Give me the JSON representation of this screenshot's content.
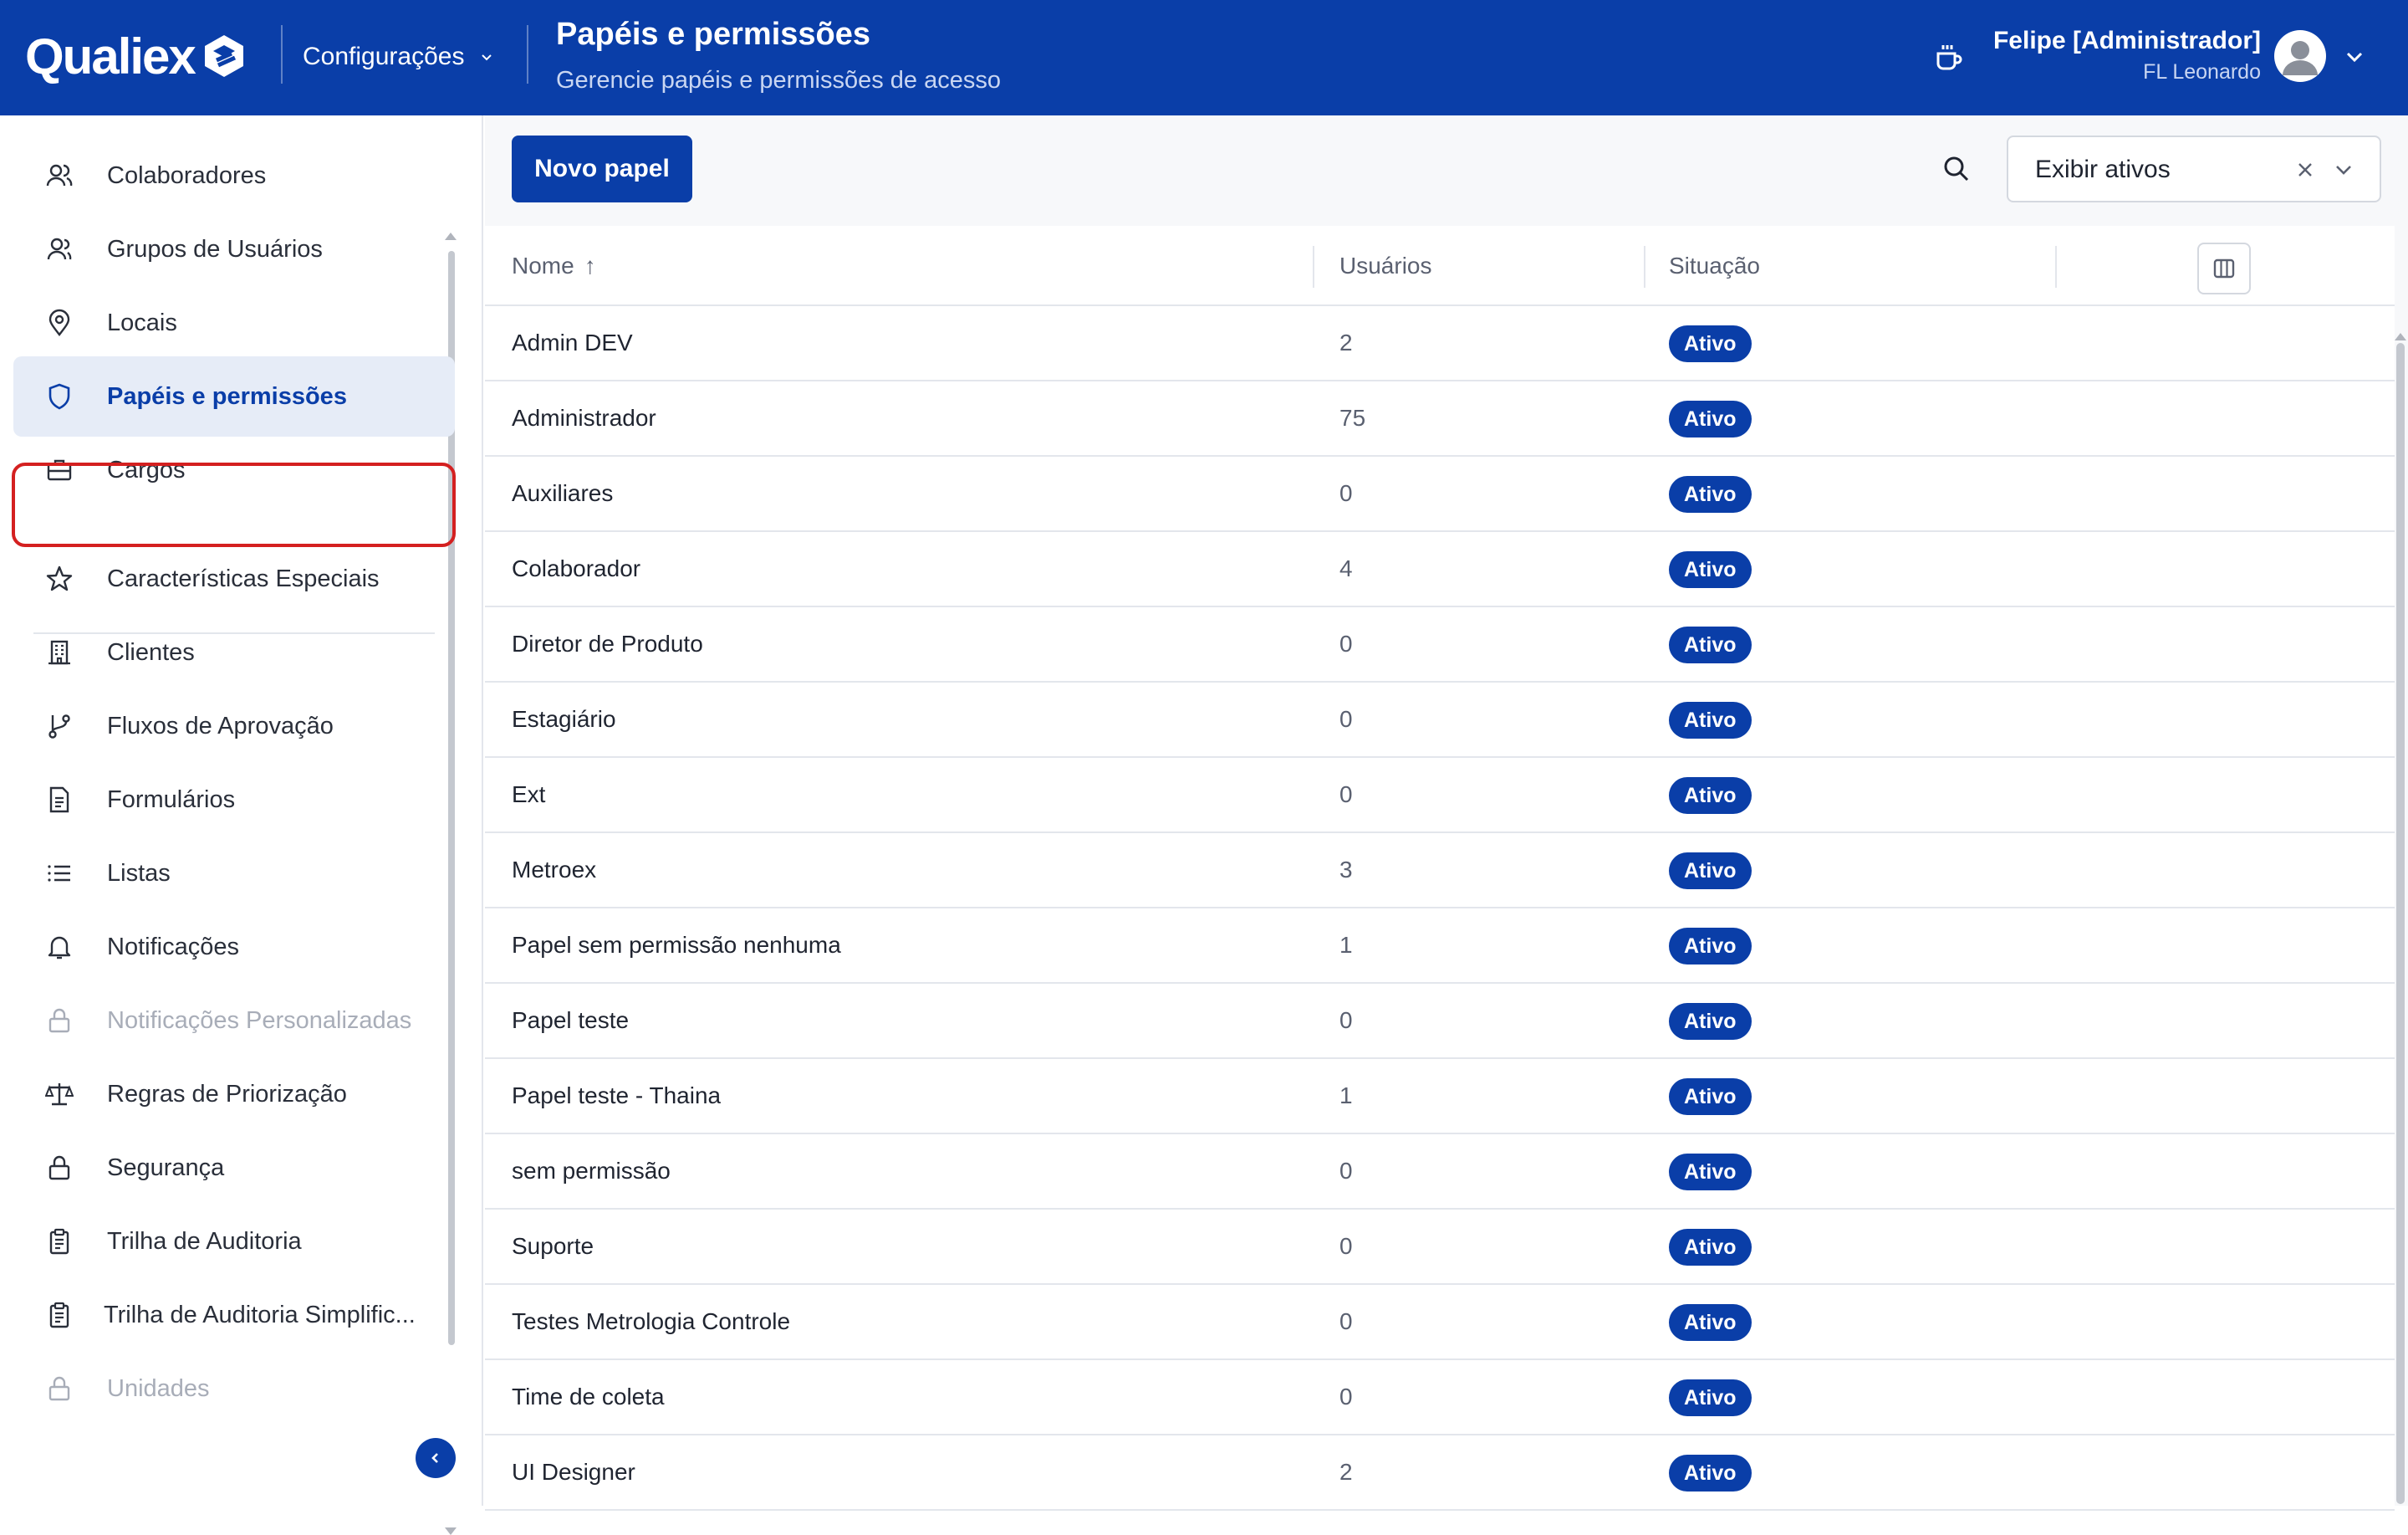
{
  "header": {
    "logo_text": "Qualiex",
    "section_label": "Configurações",
    "title": "Papéis e permissões",
    "subtitle": "Gerencie papéis e permissões de acesso",
    "user_name": "Felipe [Administrador]",
    "user_org": "FL Leonardo",
    "brand_color": "#0a3ea8"
  },
  "sidebar": {
    "items": [
      {
        "label": "Colaboradores",
        "icon": "users-icon"
      },
      {
        "label": "Grupos de Usuários",
        "icon": "user-group-icon"
      },
      {
        "label": "Locais",
        "icon": "map-pin-icon"
      },
      {
        "label": "Papéis e permissões",
        "icon": "shield-icon",
        "active": true
      },
      {
        "label": "Cargos",
        "icon": "briefcase-icon"
      },
      {
        "label": "Características Especiais",
        "icon": "star-icon"
      },
      {
        "label": "Clientes",
        "icon": "building-icon"
      },
      {
        "label": "Fluxos de Aprovação",
        "icon": "git-branch-icon"
      },
      {
        "label": "Formulários",
        "icon": "document-icon"
      },
      {
        "label": "Listas",
        "icon": "list-icon"
      },
      {
        "label": "Notificações",
        "icon": "bell-icon"
      },
      {
        "label": "Notificações Personalizadas",
        "icon": "lock-icon",
        "disabled": true
      },
      {
        "label": "Regras de Priorização",
        "icon": "scale-icon"
      },
      {
        "label": "Segurança",
        "icon": "lock-icon"
      },
      {
        "label": "Trilha de Auditoria",
        "icon": "clipboard-icon"
      },
      {
        "label": "Trilha de Auditoria Simplific...",
        "icon": "clipboard-icon"
      },
      {
        "label": "Unidades",
        "icon": "lock-icon",
        "disabled": true
      }
    ]
  },
  "toolbar": {
    "new_button": "Novo papel",
    "filter_value": "Exibir ativos"
  },
  "table": {
    "columns": [
      "Nome",
      "Usuários",
      "Situação"
    ],
    "sort_indicator": "↑",
    "rows": [
      {
        "name": "Admin DEV",
        "users": "2",
        "status": "Ativo"
      },
      {
        "name": "Administrador",
        "users": "75",
        "status": "Ativo"
      },
      {
        "name": "Auxiliares",
        "users": "0",
        "status": "Ativo"
      },
      {
        "name": "Colaborador",
        "users": "4",
        "status": "Ativo"
      },
      {
        "name": "Diretor de Produto",
        "users": "0",
        "status": "Ativo"
      },
      {
        "name": "Estagiário",
        "users": "0",
        "status": "Ativo"
      },
      {
        "name": "Ext",
        "users": "0",
        "status": "Ativo"
      },
      {
        "name": "Metroex",
        "users": "3",
        "status": "Ativo"
      },
      {
        "name": "Papel sem permissão nenhuma",
        "users": "1",
        "status": "Ativo"
      },
      {
        "name": "Papel teste",
        "users": "0",
        "status": "Ativo"
      },
      {
        "name": "Papel teste - Thaina",
        "users": "1",
        "status": "Ativo"
      },
      {
        "name": "sem permissão",
        "users": "0",
        "status": "Ativo"
      },
      {
        "name": "Suporte",
        "users": "0",
        "status": "Ativo"
      },
      {
        "name": "Testes Metrologia Controle",
        "users": "0",
        "status": "Ativo"
      },
      {
        "name": "Time de coleta",
        "users": "0",
        "status": "Ativo"
      },
      {
        "name": "UI Designer",
        "users": "2",
        "status": "Ativo"
      }
    ]
  }
}
